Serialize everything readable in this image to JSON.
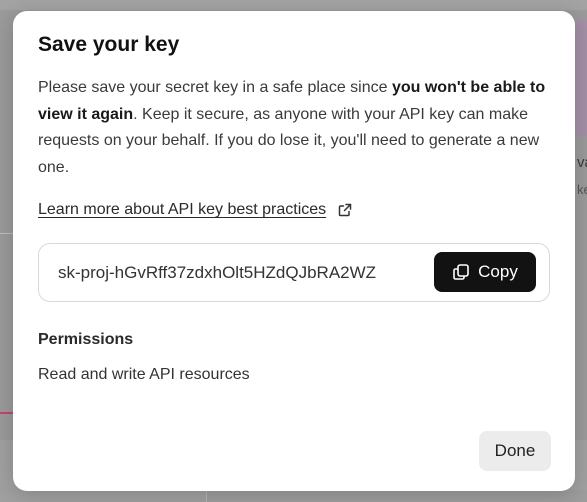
{
  "modal": {
    "title": "Save your key",
    "description_part1": "Please save your secret key in a safe place since ",
    "description_bold": "you won't be able to view it again",
    "description_part2": ". Keep it secure, as anyone with your API key can make requests on your behalf. If you do lose it, you'll need to generate a new one.",
    "learn_more_link": "Learn more about API key best practices",
    "learn_more_icon": "external-link-icon",
    "secret_key": "sk-proj-hGvRff37zdxhOlt5HZdQJbRA2WZ",
    "copy_label": "Copy",
    "copy_icon": "copy-icon",
    "permissions_heading": "Permissions",
    "permissions_value": "Read and write API resources",
    "done_label": "Done"
  },
  "background": {
    "right_text_1": "va",
    "right_text_2": "ke"
  },
  "colors": {
    "overlay": "#9a9a9a",
    "modal_bg": "#ffffff",
    "copy_button_bg": "#121212",
    "done_button_bg": "#ececec",
    "accent_line": "#c2456a"
  }
}
